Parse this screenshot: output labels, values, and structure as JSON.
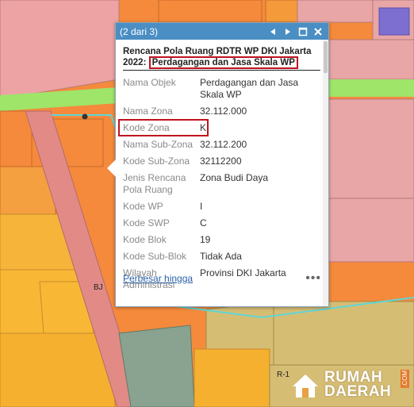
{
  "popup": {
    "pager": "(2 dari 3)",
    "title_prefix": "Rencana Pola Ruang RDTR WP DKI Jakarta 2022:",
    "title_highlight": "Perdagangan dan Jasa Skala WP",
    "rows": [
      {
        "key": "Nama Objek",
        "value": "Perdagangan dan Jasa Skala WP"
      },
      {
        "key": "Nama Zona",
        "value": "32.112.000"
      },
      {
        "key": "Kode Zona",
        "value": "K"
      },
      {
        "key": "Nama Sub-Zona",
        "value": "32.112.200"
      },
      {
        "key": "Kode Sub-Zona",
        "value": "32112200"
      },
      {
        "key": "Jenis Rencana Pola Ruang",
        "value": "Zona Budi Daya"
      },
      {
        "key": "Kode WP",
        "value": "I"
      },
      {
        "key": "Kode SWP",
        "value": "C"
      },
      {
        "key": "Kode Blok",
        "value": "19"
      },
      {
        "key": "Kode Sub-Blok",
        "value": "Tidak Ada"
      },
      {
        "key": "Wilayah Administrasi",
        "value": "Provinsi DKI Jakarta"
      }
    ],
    "zoom_link": "Perbesar hingga",
    "more": "•••"
  },
  "map": {
    "labels": {
      "bj": "BJ",
      "r1": "R-1"
    }
  },
  "logo": {
    "line1": "RUMAH",
    "line2": "DAERAH",
    "suffix": ".COM"
  }
}
